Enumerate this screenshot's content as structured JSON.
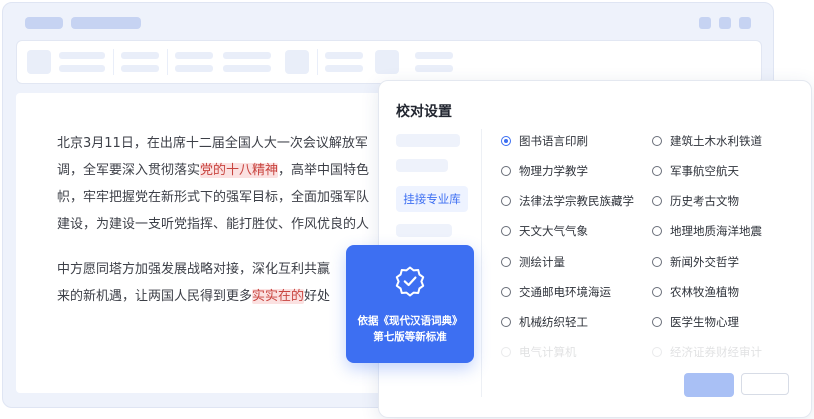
{
  "document": {
    "paragraph1": [
      [
        "北京3月11日，在出席十二届全国人大一次会议解放军"
      ],
      [
        "调，全军要深入贯彻落实",
        "党的十八精神",
        "，高举中国特色"
      ],
      [
        "帜，牢牢把握党在新形式下的强军目标，全面加强军队"
      ],
      [
        "建设，为建设一支听党指挥、能打胜仗、作风优良的人"
      ]
    ],
    "paragraph2": [
      [
        "中方愿同塔方加强发展战略对接，深化互利共赢"
      ],
      [
        "来的新机遇，让两国人民得到更多",
        "实实在的",
        "好处"
      ]
    ]
  },
  "callout": {
    "line1": "依据《现代汉语词典》",
    "line2": "第七版等新标准"
  },
  "panel": {
    "title": "校对设置",
    "active_nav": "挂接专业库",
    "options_left": [
      {
        "label": "图书语言印刷",
        "selected": true
      },
      {
        "label": "物理力学教学",
        "selected": false
      },
      {
        "label": "法律法学宗教民族藏学",
        "selected": false
      },
      {
        "label": "天文大气气象",
        "selected": false
      },
      {
        "label": "测绘计量",
        "selected": false
      },
      {
        "label": "交通邮电环境海运",
        "selected": false
      },
      {
        "label": "机械纺织轻工",
        "selected": false
      },
      {
        "label": "电气计算机",
        "selected": false
      }
    ],
    "options_right": [
      {
        "label": "建筑土木水利铁道",
        "selected": false
      },
      {
        "label": "军事航空航天",
        "selected": false
      },
      {
        "label": "历史考古文物",
        "selected": false
      },
      {
        "label": "地理地质海洋地震",
        "selected": false
      },
      {
        "label": "新闻外交哲学",
        "selected": false
      },
      {
        "label": "农林牧渔植物",
        "selected": false
      },
      {
        "label": "医学生物心理",
        "selected": false
      },
      {
        "label": "经济证券财经审计",
        "selected": false
      }
    ]
  },
  "colors": {
    "accent": "#3d6ff2",
    "highlight_bg": "#fbe1e1",
    "highlight_text": "#c8443f"
  }
}
